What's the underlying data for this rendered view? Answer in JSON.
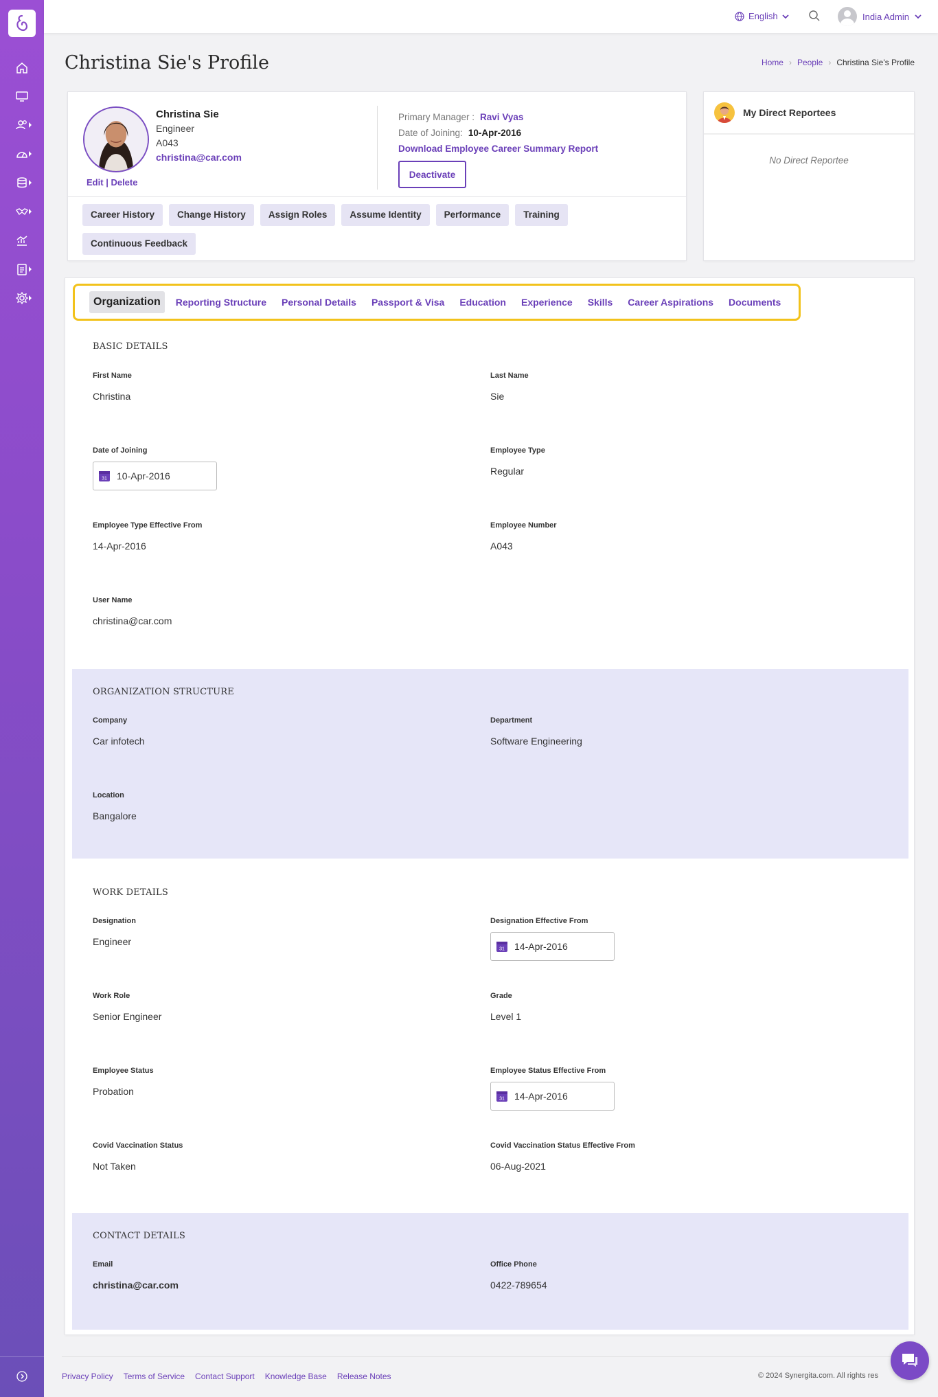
{
  "topbar": {
    "language": "English",
    "user_name": "India Admin"
  },
  "page": {
    "title": "Christina Sie's Profile"
  },
  "breadcrumb": {
    "home": "Home",
    "people": "People",
    "current": "Christina Sie's Profile"
  },
  "profile": {
    "name": "Christina Sie",
    "designation": "Engineer",
    "employee_number": "A043",
    "email": "christina@car.com",
    "edit_label": "Edit",
    "separator": "|",
    "delete_label": "Delete",
    "primary_manager_label": "Primary Manager :",
    "primary_manager": "Ravi Vyas",
    "doj_label": "Date of Joining:",
    "doj": "10-Apr-2016",
    "download_report": "Download Employee Career Summary Report",
    "deactivate_label": "Deactivate"
  },
  "actions": [
    "Career History",
    "Change History",
    "Assign Roles",
    "Assume Identity",
    "Performance",
    "Training",
    "Continuous Feedback"
  ],
  "reportees": {
    "title": "My Direct Reportees",
    "empty": "No Direct Reportee"
  },
  "tabs": [
    "Organization",
    "Reporting Structure",
    "Personal Details",
    "Passport & Visa",
    "Education",
    "Experience",
    "Skills",
    "Career Aspirations",
    "Documents"
  ],
  "basic": {
    "title": "BASIC DETAILS",
    "first_name_label": "First Name",
    "first_name": "Christina",
    "last_name_label": "Last Name",
    "last_name": "Sie",
    "doj_label": "Date of Joining",
    "doj": "10-Apr-2016",
    "emp_type_label": "Employee Type",
    "emp_type": "Regular",
    "emp_type_eff_label": "Employee Type Effective From",
    "emp_type_eff": "14-Apr-2016",
    "emp_no_label": "Employee Number",
    "emp_no": "A043",
    "username_label": "User Name",
    "username": "christina@car.com"
  },
  "org": {
    "title": "ORGANIZATION STRUCTURE",
    "company_label": "Company",
    "company": "Car infotech",
    "department_label": "Department",
    "department": "Software Engineering",
    "location_label": "Location",
    "location": "Bangalore"
  },
  "work": {
    "title": "WORK DETAILS",
    "designation_label": "Designation",
    "designation": "Engineer",
    "designation_eff_label": "Designation Effective From",
    "designation_eff": "14-Apr-2016",
    "work_role_label": "Work Role",
    "work_role": "Senior Engineer",
    "grade_label": "Grade",
    "grade": "Level 1",
    "status_label": "Employee Status",
    "status": "Probation",
    "status_eff_label": "Employee Status Effective From",
    "status_eff": "14-Apr-2016",
    "covid_label": "Covid Vaccination Status",
    "covid": "Not Taken",
    "covid_eff_label": "Covid Vaccination Status Effective From",
    "covid_eff": "06-Aug-2021"
  },
  "contact": {
    "title": "CONTACT DETAILS",
    "email_label": "Email",
    "email": "christina@car.com",
    "phone_label": "Office Phone",
    "phone": "0422-789654"
  },
  "calendar_day": "31",
  "footer": {
    "links": [
      "Privacy Policy",
      "Terms of Service",
      "Contact Support",
      "Knowledge Base",
      "Release Notes"
    ],
    "copyright": "© 2024 Synergita.com. All rights res"
  },
  "colors": {
    "accent": "#6a3fb8",
    "sidebar_top": "#9b4fd4",
    "highlight": "#f2c21b",
    "shaded": "#e6e6f8"
  }
}
